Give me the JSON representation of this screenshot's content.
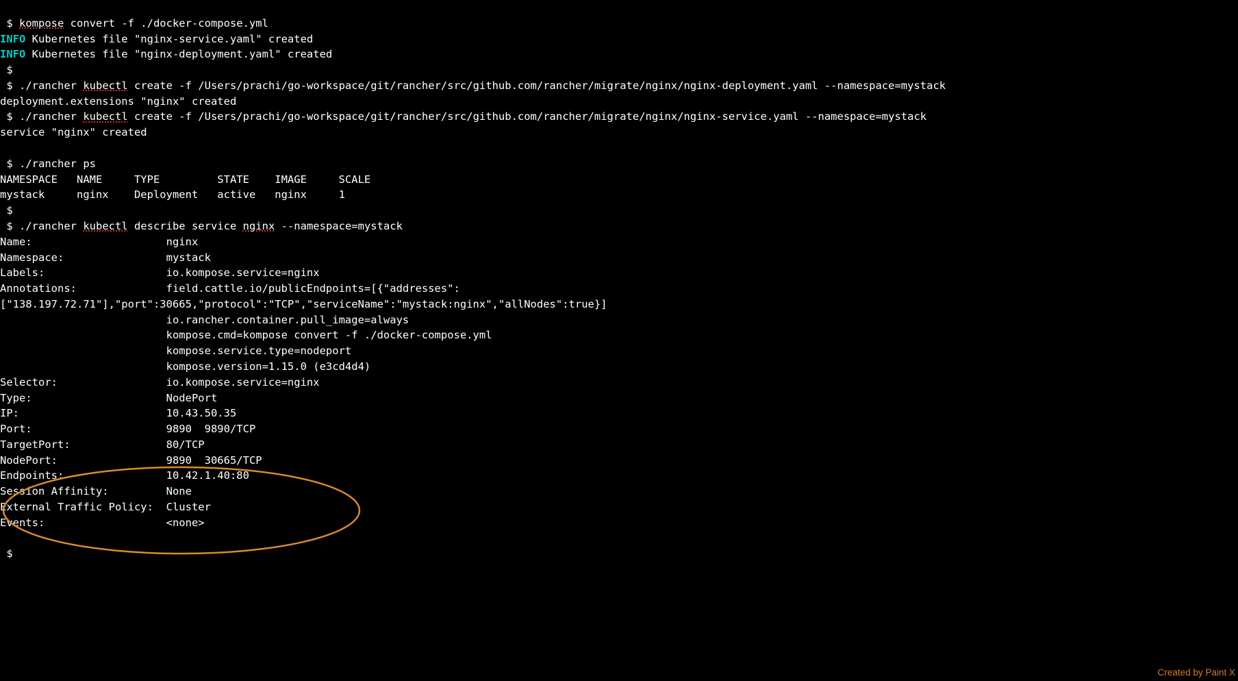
{
  "lines": {
    "l1_prompt": " $ ",
    "l1_cmd_pre": "kompose",
    "l1_cmd_rest": " convert -f ./docker-compose.yml",
    "l2_info": "INFO",
    "l2_rest": " Kubernetes file \"nginx-service.yaml\" created",
    "l3_info": "INFO",
    "l3_rest": " Kubernetes file \"nginx-deployment.yaml\" created",
    "l4_prompt": " $",
    "l5_prompt": " $ ",
    "l5_cmd1": "./rancher ",
    "l5_cmd_u": "kubectl",
    "l5_cmd2": " create -f /Users/prachi/go-workspace/git/rancher/src/github.com/rancher/migrate/nginx/nginx-deployment.yaml --namespace=mystack",
    "l6": "deployment.extensions \"nginx\" created",
    "l7_prompt": " $ ",
    "l7_cmd1": "./rancher ",
    "l7_cmd_u": "kubectl",
    "l7_cmd2": " create -f /Users/prachi/go-workspace/git/rancher/src/github.com/rancher/migrate/nginx/nginx-service.yaml --namespace=mystack",
    "l8": "service \"nginx\" created",
    "lblank": "",
    "l9_prompt": " $ ",
    "l9_cmd": "./rancher ps",
    "l10": "NAMESPACE   NAME     TYPE         STATE    IMAGE     SCALE",
    "l11": "mystack     nginx    Deployment   active   nginx     1",
    "l12_prompt": " $",
    "l13_prompt": " $ ",
    "l13_cmd1": "./rancher ",
    "l13_cmd_u": "kubectl",
    "l13_cmd2": " describe service ",
    "l13_cmd_u2": "nginx",
    "l13_cmd3": " --namespace=mystack",
    "d_name": "Name:                     nginx",
    "d_namespace": "Namespace:                mystack",
    "d_labels": "Labels:                   io.kompose.service=nginx",
    "d_ann1": "Annotations:              field.cattle.io/publicEndpoints=[{\"addresses\":",
    "d_ann2": "[\"138.197.72.71\"],\"port\":30665,\"protocol\":\"TCP\",\"serviceName\":\"mystack:nginx\",\"allNodes\":true}]",
    "d_ann3": "                          io.rancher.container.pull_image=always",
    "d_ann4": "                          kompose.cmd=kompose convert -f ./docker-compose.yml",
    "d_ann5": "                          kompose.service.type=nodeport",
    "d_ann6": "                          kompose.version=1.15.0 (e3cd4d4)",
    "d_selector": "Selector:                 io.kompose.service=nginx",
    "d_type": "Type:                     NodePort",
    "d_ip": "IP:                       10.43.50.35",
    "d_port": "Port:                     9890  9890/TCP",
    "d_targetport": "TargetPort:               80/TCP",
    "d_nodeport": "NodePort:                 9890  30665/TCP",
    "d_endpoints": "Endpoints:                10.42.1.40:80",
    "d_sessaff": "Session Affinity:         None",
    "d_exttraf": "External Traffic Policy:  Cluster",
    "d_events": "Events:                   <none>",
    "l_end_blank": "",
    "l_end_prompt": " $",
    "watermark": "Created by Paint X"
  }
}
